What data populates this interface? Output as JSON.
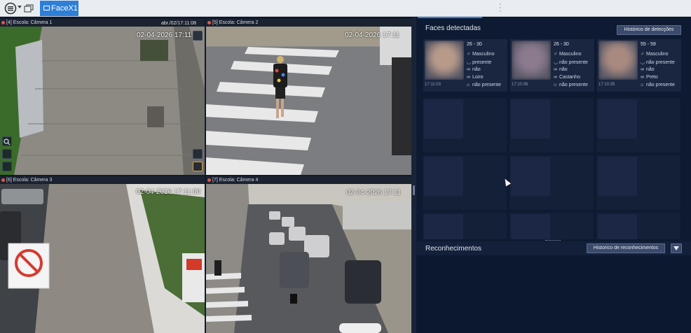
{
  "app": {
    "tab_label": "FaceX1"
  },
  "cameras": [
    {
      "label": "[4] Escola: Câmera 1",
      "timestamp": "02-04-2026 17:11",
      "timestamp_small": "abr./02/17:11:08"
    },
    {
      "label": "[5] Escola: Câmera 2",
      "timestamp": "02-04-2026 17:11"
    },
    {
      "label": "[6] Escola: Câmera 3",
      "timestamp": "02-04-2026 17:11:00"
    },
    {
      "label": "[7] Escola: Câmera 4",
      "timestamp": "02-04-2026 17:11"
    }
  ],
  "panel": {
    "faces_title": "Faces detectadas",
    "faces_history_button": "Histórico de detecções",
    "recognitions_title": "Reconhecimentos",
    "recognitions_history_button": "Historico de reconhecimentos"
  },
  "faces": [
    {
      "age": "26 - 30",
      "gender": "Masculino",
      "mask": "presente",
      "glasses": "não",
      "hair": "Loiro",
      "hat": "não presente",
      "time": "17:11:03",
      "tone": "#b89a8a"
    },
    {
      "age": "26 - 30",
      "gender": "Masculino",
      "mask": "não presente",
      "glasses": "não",
      "hair": "Castanho",
      "hat": "não presente",
      "time": "17:10:36",
      "tone": "#8c7a8f"
    },
    {
      "age": "55 - 59",
      "gender": "Masculino",
      "mask": "não presente",
      "glasses": "não",
      "hair": "Preto",
      "hat": "não presente",
      "time": "17:10:35",
      "tone": "#a98a80"
    }
  ],
  "icons": {
    "gender": "male-icon",
    "mask": "mask-icon",
    "glasses": "glasses-icon",
    "hat": "hat-icon"
  }
}
